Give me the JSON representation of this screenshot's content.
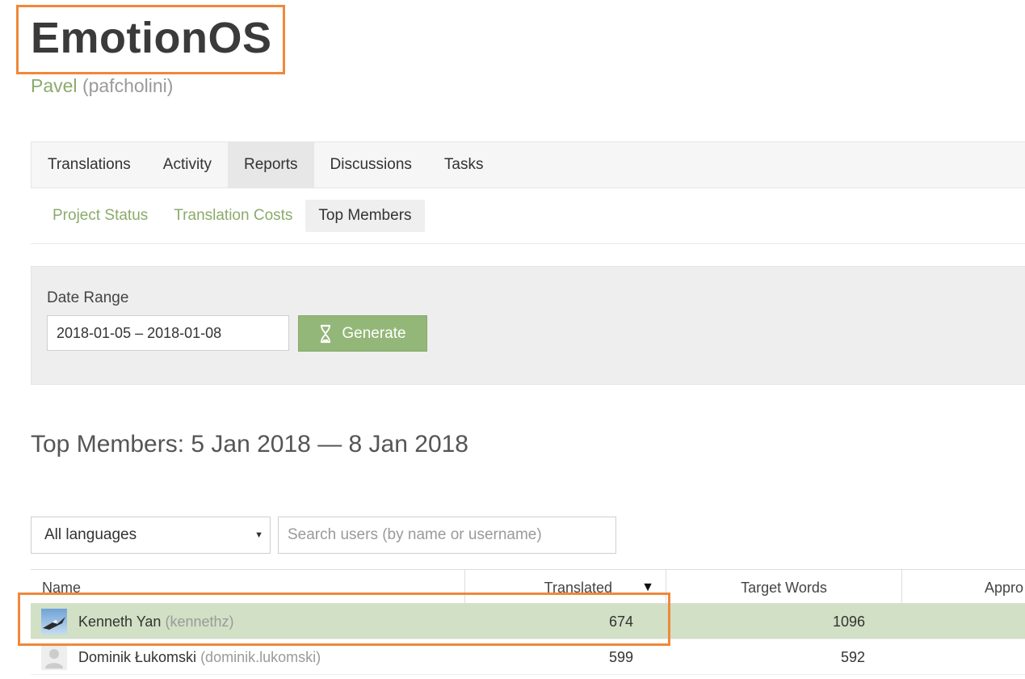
{
  "header": {
    "project_title": "EmotionOS",
    "owner_name": "Pavel",
    "owner_username": "(pafcholini)"
  },
  "main_tabs": [
    {
      "label": "Translations",
      "active": false
    },
    {
      "label": "Activity",
      "active": false
    },
    {
      "label": "Reports",
      "active": true
    },
    {
      "label": "Discussions",
      "active": false
    },
    {
      "label": "Tasks",
      "active": false
    }
  ],
  "sub_tabs": [
    {
      "label": "Project Status",
      "active": false
    },
    {
      "label": "Translation Costs",
      "active": false
    },
    {
      "label": "Top Members",
      "active": true
    }
  ],
  "date_range": {
    "label": "Date Range",
    "value": "2018-01-05 – 2018-01-08",
    "generate_label": "Generate"
  },
  "section_heading": "Top Members: 5 Jan 2018 — 8 Jan 2018",
  "filters": {
    "language_selected": "All languages",
    "search_placeholder": "Search users (by name or username)"
  },
  "table": {
    "columns": {
      "name": "Name",
      "translated": "Translated",
      "target_words": "Target Words",
      "approved": "Appro"
    },
    "sort_indicator": "▼",
    "rows": [
      {
        "name": "Kenneth Yan",
        "username": "(kennethz)",
        "translated": "674",
        "target_words": "1096",
        "avatar": "bird-photo-avatar",
        "highlighted": true
      },
      {
        "name": "Dominik Łukomski",
        "username": "(dominik.lukomski)",
        "translated": "599",
        "target_words": "592",
        "avatar": "default-user-avatar",
        "highlighted": false
      }
    ]
  },
  "colors": {
    "accent_green": "#8bab6b",
    "button_green": "#93b778",
    "highlight_row": "#d2e0c5",
    "annotation_orange": "#f0883a"
  }
}
